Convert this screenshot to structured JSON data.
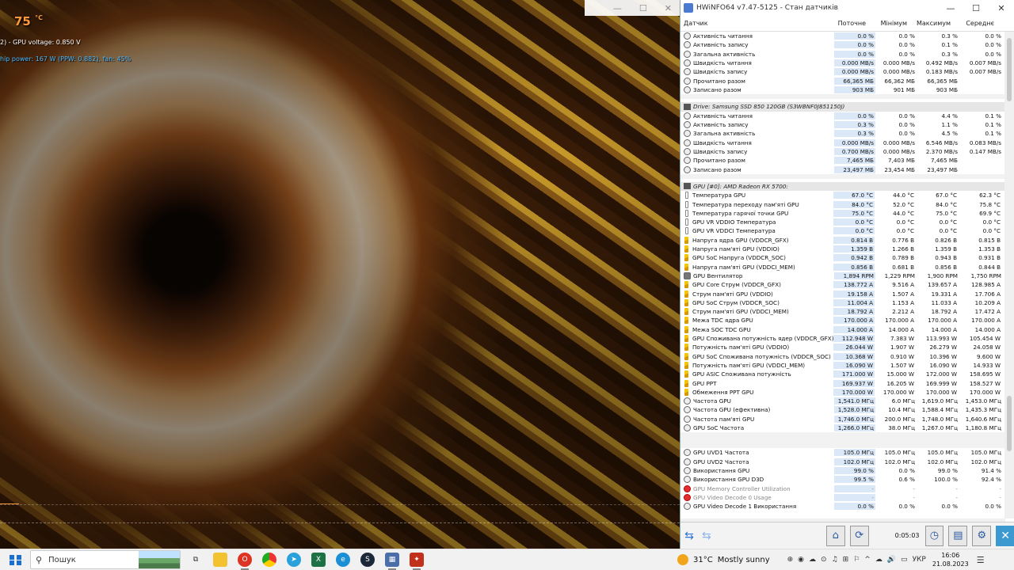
{
  "osd": {
    "temp": "75",
    "temp_unit": "°C",
    "voltage_line": "2) - GPU voltage: 0.850 V",
    "power_line": "hip power: 167 W (PPW: 0.882), fan: 45%"
  },
  "window": {
    "title": "HWiNFO64 v7.47-5125 - Стан датчиків",
    "minimize": "—",
    "maximize": "☐",
    "close": "✕"
  },
  "columns": {
    "name": "Датчик",
    "current": "Поточне",
    "min": "Мінімум",
    "max": "Максимум",
    "avg": "Середнє"
  },
  "sections": [
    {
      "header": "",
      "rows": [
        {
          "icon": "circle",
          "name": "Активність читання",
          "cur": "0.0 %",
          "min": "0.0 %",
          "max": "0.3 %",
          "avg": "0.0 %"
        },
        {
          "icon": "circle",
          "name": "Активність запису",
          "cur": "0.0 %",
          "min": "0.0 %",
          "max": "0.1 %",
          "avg": "0.0 %"
        },
        {
          "icon": "circle",
          "name": "Загальна активність",
          "cur": "0.0 %",
          "min": "0.0 %",
          "max": "0.3 %",
          "avg": "0.0 %"
        },
        {
          "icon": "circle",
          "name": "Швидкість читання",
          "cur": "0.000 MB/s",
          "min": "0.000 MB/s",
          "max": "0.492 MB/s",
          "avg": "0.007 MB/s"
        },
        {
          "icon": "circle",
          "name": "Швидкість запису",
          "cur": "0.000 MB/s",
          "min": "0.000 MB/s",
          "max": "0.183 MB/s",
          "avg": "0.007 MB/s"
        },
        {
          "icon": "circle",
          "name": "Прочитано разом",
          "cur": "66,365 МБ",
          "min": "66,362 МБ",
          "max": "66,365 МБ",
          "avg": ""
        },
        {
          "icon": "circle",
          "name": "Записано разом",
          "cur": "903 МБ",
          "min": "901 МБ",
          "max": "903 МБ",
          "avg": ""
        }
      ]
    },
    {
      "header": "Drive: Samsung SSD 850 120GB (S3WBNF0J851150J)",
      "rows": [
        {
          "icon": "circle",
          "name": "Активність читання",
          "cur": "0.0 %",
          "min": "0.0 %",
          "max": "4.4 %",
          "avg": "0.1 %"
        },
        {
          "icon": "circle",
          "name": "Активність запису",
          "cur": "0.3 %",
          "min": "0.0 %",
          "max": "1.1 %",
          "avg": "0.1 %"
        },
        {
          "icon": "circle",
          "name": "Загальна активність",
          "cur": "0.3 %",
          "min": "0.0 %",
          "max": "4.5 %",
          "avg": "0.1 %"
        },
        {
          "icon": "circle",
          "name": "Швидкість читання",
          "cur": "0.000 MB/s",
          "min": "0.000 MB/s",
          "max": "6.546 MB/s",
          "avg": "0.083 MB/s"
        },
        {
          "icon": "circle",
          "name": "Швидкість запису",
          "cur": "0.700 MB/s",
          "min": "0.000 MB/s",
          "max": "2.370 MB/s",
          "avg": "0.147 MB/s"
        },
        {
          "icon": "circle",
          "name": "Прочитано разом",
          "cur": "7,465 МБ",
          "min": "7,403 МБ",
          "max": "7,465 МБ",
          "avg": ""
        },
        {
          "icon": "circle",
          "name": "Записано разом",
          "cur": "23,497 МБ",
          "min": "23,454 МБ",
          "max": "23,497 МБ",
          "avg": ""
        }
      ]
    },
    {
      "header": "GPU [#0]: AMD Radeon RX 5700:",
      "rows": [
        {
          "icon": "therm",
          "name": "Температура GPU",
          "cur": "67.0 °C",
          "min": "44.0 °C",
          "max": "67.0 °C",
          "avg": "62.3 °C"
        },
        {
          "icon": "therm",
          "name": "Температура переходу пам'яті GPU",
          "cur": "84.0 °C",
          "min": "52.0 °C",
          "max": "84.0 °C",
          "avg": "75.8 °C"
        },
        {
          "icon": "therm",
          "name": "Температура гарячої точки GPU",
          "cur": "75.0 °C",
          "min": "44.0 °C",
          "max": "75.0 °C",
          "avg": "69.9 °C"
        },
        {
          "icon": "therm",
          "name": "GPU VR VDDIO Температура",
          "cur": "0.0 °C",
          "min": "0.0 °C",
          "max": "0.0 °C",
          "avg": "0.0 °C"
        },
        {
          "icon": "therm",
          "name": "GPU VR VDDCI Температура",
          "cur": "0.0 °C",
          "min": "0.0 °C",
          "max": "0.0 °C",
          "avg": "0.0 °C"
        },
        {
          "icon": "bolt",
          "name": "Напруга ядра GPU (VDDCR_GFX)",
          "cur": "0.814 В",
          "min": "0.776 В",
          "max": "0.826 В",
          "avg": "0.815 В"
        },
        {
          "icon": "bolt",
          "name": "Напруга пам'яті GPU (VDDIO)",
          "cur": "1.359 В",
          "min": "1.266 В",
          "max": "1.359 В",
          "avg": "1.353 В"
        },
        {
          "icon": "bolt",
          "name": "GPU SoC Напруга (VDDCR_SOC)",
          "cur": "0.942 В",
          "min": "0.789 В",
          "max": "0.943 В",
          "avg": "0.931 В"
        },
        {
          "icon": "bolt",
          "name": "Напруга пам'яті GPU (VDDCI_MEM)",
          "cur": "0.856 В",
          "min": "0.681 В",
          "max": "0.856 В",
          "avg": "0.844 В"
        },
        {
          "icon": "fan",
          "name": "GPU Вентилятор",
          "cur": "1,894 RPM",
          "min": "1,229 RPM",
          "max": "1,900 RPM",
          "avg": "1,750 RPM"
        },
        {
          "icon": "bolt",
          "name": "GPU Core Струм (VDDCR_GFX)",
          "cur": "138.772 A",
          "min": "9.516 A",
          "max": "139.657 A",
          "avg": "128.985 A"
        },
        {
          "icon": "bolt",
          "name": "Струм пам'яті GPU (VDDIO)",
          "cur": "19.158 A",
          "min": "1.507 A",
          "max": "19.331 A",
          "avg": "17.706 A"
        },
        {
          "icon": "bolt",
          "name": "GPU SoC Струм (VDDCR_SOC)",
          "cur": "11.004 A",
          "min": "1.153 A",
          "max": "11.033 A",
          "avg": "10.209 A"
        },
        {
          "icon": "bolt",
          "name": "Струм пам'яті GPU (VDDCI_MEM)",
          "cur": "18.792 A",
          "min": "2.212 A",
          "max": "18.792 A",
          "avg": "17.472 A"
        },
        {
          "icon": "bolt",
          "name": "Межа TDC ядра GPU",
          "cur": "170.000 A",
          "min": "170.000 A",
          "max": "170.000 A",
          "avg": "170.000 A"
        },
        {
          "icon": "bolt",
          "name": "Межа SOC TDC GPU",
          "cur": "14.000 A",
          "min": "14.000 A",
          "max": "14.000 A",
          "avg": "14.000 A"
        },
        {
          "icon": "bolt",
          "name": "GPU Споживана потужність ядер (VDDCR_GFX)",
          "cur": "112.948 W",
          "min": "7.383 W",
          "max": "113.993 W",
          "avg": "105.454 W"
        },
        {
          "icon": "bolt",
          "name": "Потужність пам'яті GPU (VDDIO)",
          "cur": "26.044 W",
          "min": "1.907 W",
          "max": "26.279 W",
          "avg": "24.058 W"
        },
        {
          "icon": "bolt",
          "name": "GPU SoC Споживана потужність (VDDCR_SOC)",
          "cur": "10.368 W",
          "min": "0.910 W",
          "max": "10.396 W",
          "avg": "9.600 W"
        },
        {
          "icon": "bolt",
          "name": "Потужність пам'яті GPU (VDDCI_MEM)",
          "cur": "16.090 W",
          "min": "1.507 W",
          "max": "16.090 W",
          "avg": "14.933 W"
        },
        {
          "icon": "bolt",
          "name": "GPU ASIC Споживана потужність",
          "cur": "171.000 W",
          "min": "15.000 W",
          "max": "172.000 W",
          "avg": "158.695 W"
        },
        {
          "icon": "bolt",
          "name": "GPU PPT",
          "cur": "169.937 W",
          "min": "16.205 W",
          "max": "169.999 W",
          "avg": "158.527 W"
        },
        {
          "icon": "bolt",
          "name": "Обмеження PPT GPU",
          "cur": "170.000 W",
          "min": "170.000 W",
          "max": "170.000 W",
          "avg": "170.000 W"
        },
        {
          "icon": "circle",
          "name": "Частота GPU",
          "cur": "1,541.0 МГц",
          "min": "6.0 МГц",
          "max": "1,619.0 МГц",
          "avg": "1,453.0 МГц"
        },
        {
          "icon": "circle",
          "name": "Частота GPU (ефективна)",
          "cur": "1,528.0 МГц",
          "min": "10.4 МГц",
          "max": "1,588.4 МГц",
          "avg": "1,435.3 МГц"
        },
        {
          "icon": "circle",
          "name": "Частота пам'яті GPU",
          "cur": "1,746.0 МГц",
          "min": "200.0 МГц",
          "max": "1,748.0 МГц",
          "avg": "1,640.6 МГц"
        },
        {
          "icon": "circle",
          "name": "GPU SoC Частота",
          "cur": "1,266.0 МГц",
          "min": "38.0 МГц",
          "max": "1,267.0 МГц",
          "avg": "1,180.8 МГц"
        }
      ]
    },
    {
      "header": "",
      "rows": [
        {
          "icon": "circle",
          "name": "GPU UVD1 Частота",
          "cur": "105.0 МГц",
          "min": "105.0 МГц",
          "max": "105.0 МГц",
          "avg": "105.0 МГц"
        },
        {
          "icon": "circle",
          "name": "GPU UVD2 Частота",
          "cur": "102.0 МГц",
          "min": "102.0 МГц",
          "max": "102.0 МГц",
          "avg": "102.0 МГц"
        },
        {
          "icon": "circle",
          "name": "Використання GPU",
          "cur": "99.0 %",
          "min": "0.0 %",
          "max": "99.0 %",
          "avg": "91.4 %"
        },
        {
          "icon": "circle",
          "name": "Використання GPU D3D",
          "cur": "99.5 %",
          "min": "0.6 %",
          "max": "100.0 %",
          "avg": "92.4 %"
        },
        {
          "icon": "err",
          "name": "GPU Memory Controller Utilization",
          "cur": "-",
          "min": "-",
          "max": "-",
          "avg": "-"
        },
        {
          "icon": "err",
          "name": "GPU Video Decode 0 Usage",
          "cur": "-",
          "min": "-",
          "max": "-",
          "avg": "-"
        },
        {
          "icon": "circle",
          "name": "GPU Video Decode 1 Використання",
          "cur": "0.0 %",
          "min": "0.0 %",
          "max": "0.0 %",
          "avg": "0.0 %"
        }
      ]
    }
  ],
  "toolbar": {
    "timer": "0:05:03"
  },
  "taskbar": {
    "search_placeholder": "Пошук",
    "weather_temp": "31°C",
    "weather_text": "Mostly sunny",
    "lang": "УКР",
    "time": "16:06",
    "date": "21.08.2023"
  }
}
